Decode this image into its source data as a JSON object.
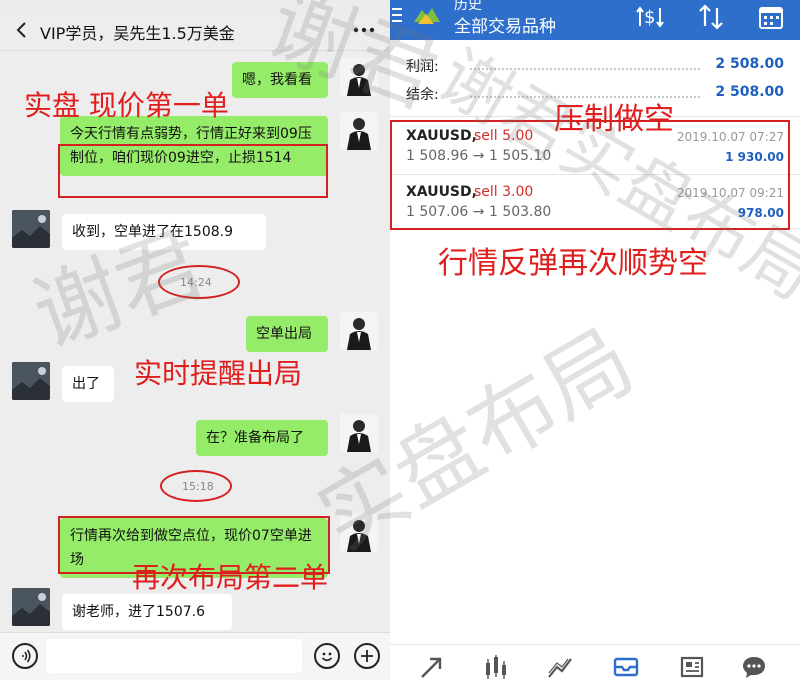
{
  "chat": {
    "title": "VIP学员，吴先生1.5万美金",
    "messages": [
      {
        "from": "me",
        "text": "嗯，我看看"
      },
      {
        "from": "me",
        "text": "今天行情有点弱势，行情正好来到09压制位，咱们现价09进空，止损1514"
      },
      {
        "from": "other",
        "text": "收到，空单进了在1508.9"
      },
      {
        "type": "time",
        "text": "14:24"
      },
      {
        "from": "me",
        "text": "空单出局"
      },
      {
        "from": "other",
        "text": "出了"
      },
      {
        "from": "me",
        "text": "在？准备布局了"
      },
      {
        "type": "time",
        "text": "15:18"
      },
      {
        "from": "me",
        "text": "行情再次给到做空点位，现价07空单进场"
      },
      {
        "from": "other",
        "text": "谢老师，进了1507.6"
      }
    ]
  },
  "annotations": {
    "first_order": "实盘 现价第一单",
    "exit_reminder": "实时提醒出局",
    "second_order": "再次布局第二单",
    "suppress_short": "压制做空",
    "rebound_short": "行情反弹再次顺势空"
  },
  "mt": {
    "header_title_top": "历史",
    "header_title": "全部交易品种",
    "summary": [
      {
        "label": "利润:",
        "value": "2 508.00"
      },
      {
        "label": "结余:",
        "value": "2 508.00"
      }
    ],
    "trades": [
      {
        "symbol": "XAUUSD,",
        "side": "sell 5.00",
        "time": "2019.10.07 07:27",
        "prices": "1 508.96 → 1 505.10",
        "profit": "1 930.00"
      },
      {
        "symbol": "XAUUSD,",
        "side": "sell 3.00",
        "time": "2019.10.07 09:21",
        "prices": "1 507.06 → 1 503.80",
        "profit": "978.00"
      }
    ]
  },
  "watermark": {
    "left_top": "谢君",
    "left_mid": "谢君",
    "center_mid": "实盘布局",
    "right_top": "谢君实盘布局"
  },
  "colors": {
    "mt_blue": "#2f6fcc",
    "chat_green": "#95ec69",
    "annotation_red": "#e01e1e",
    "profit_blue": "#1f5fbf"
  }
}
